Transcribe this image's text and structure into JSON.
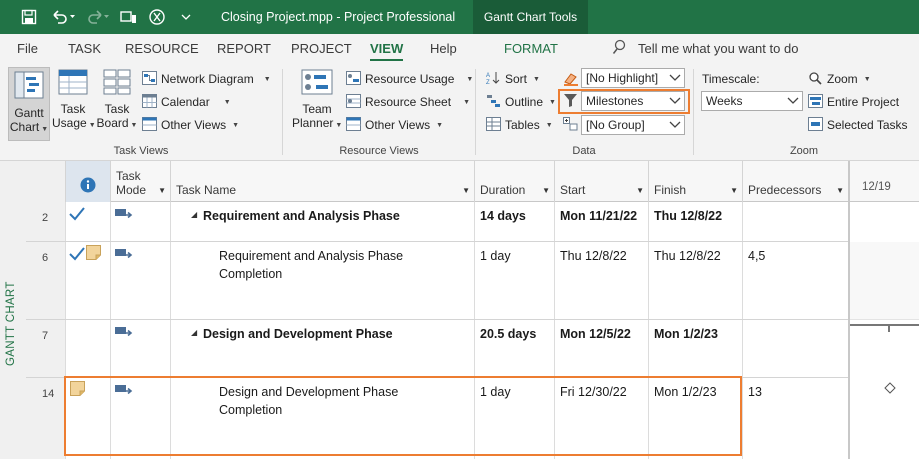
{
  "titlebar": {
    "title": "Closing Project.mpp  -  Project Professional",
    "tool_tab": "Gantt Chart Tools"
  },
  "tabs": {
    "file": "File",
    "task": "TASK",
    "resource": "RESOURCE",
    "report": "REPORT",
    "project": "PROJECT",
    "view": "VIEW",
    "help": "Help",
    "format": "FORMAT",
    "tell_me": "Tell me what you want to do"
  },
  "ribbon": {
    "task_views": {
      "label": "Task Views",
      "gantt_line1": "Gantt",
      "gantt_line2": "Chart",
      "usage_line1": "Task",
      "usage_line2": "Usage",
      "board_line1": "Task",
      "board_line2": "Board",
      "network": "Network Diagram",
      "calendar": "Calendar",
      "other": "Other Views"
    },
    "resource_views": {
      "label": "Resource Views",
      "team_line1": "Team",
      "team_line2": "Planner",
      "usage": "Resource Usage",
      "sheet": "Resource Sheet",
      "other": "Other Views"
    },
    "data": {
      "label": "Data",
      "sort": "Sort",
      "outline": "Outline",
      "tables": "Tables",
      "highlight": "[No Highlight]",
      "filter": "Milestones",
      "group": "[No Group]"
    },
    "zoom": {
      "label": "Zoom",
      "timescale_label": "Timescale:",
      "timescale_value": "Weeks",
      "zoom": "Zoom",
      "entire_project": "Entire Project",
      "selected_tasks": "Selected Tasks"
    }
  },
  "sidebar_label": "GANTT CHART",
  "columns": {
    "task_mode_line1": "Task",
    "task_mode_line2": "Mode",
    "task_name": "Task Name",
    "duration": "Duration",
    "start": "Start",
    "finish": "Finish",
    "predecessors": "Predecessors"
  },
  "timeline_header": "12/19",
  "rows": [
    {
      "id": "2",
      "name": "Requirement and Analysis Phase",
      "duration": "14 days",
      "start": "Mon 11/21/22",
      "finish": "Thu 12/8/22",
      "predecessors": ""
    },
    {
      "id": "6",
      "name_line1": "Requirement and Analysis Phase",
      "name_line2": "Completion",
      "duration": "1 day",
      "start": "Thu 12/8/22",
      "finish": "Thu 12/8/22",
      "predecessors": "4,5"
    },
    {
      "id": "7",
      "name": "Design and Development Phase",
      "duration": "20.5 days",
      "start": "Mon 12/5/22",
      "finish": "Mon 1/2/23",
      "predecessors": ""
    },
    {
      "id": "14",
      "name_line1": "Design and Development Phase",
      "name_line2": "Completion",
      "duration": "1 day",
      "start": "Fri 12/30/22",
      "finish": "Mon 1/2/23",
      "predecessors": "13"
    }
  ],
  "colors": {
    "brand": "#217346",
    "highlight": "#ed7d31",
    "check": "#2e75b6"
  }
}
